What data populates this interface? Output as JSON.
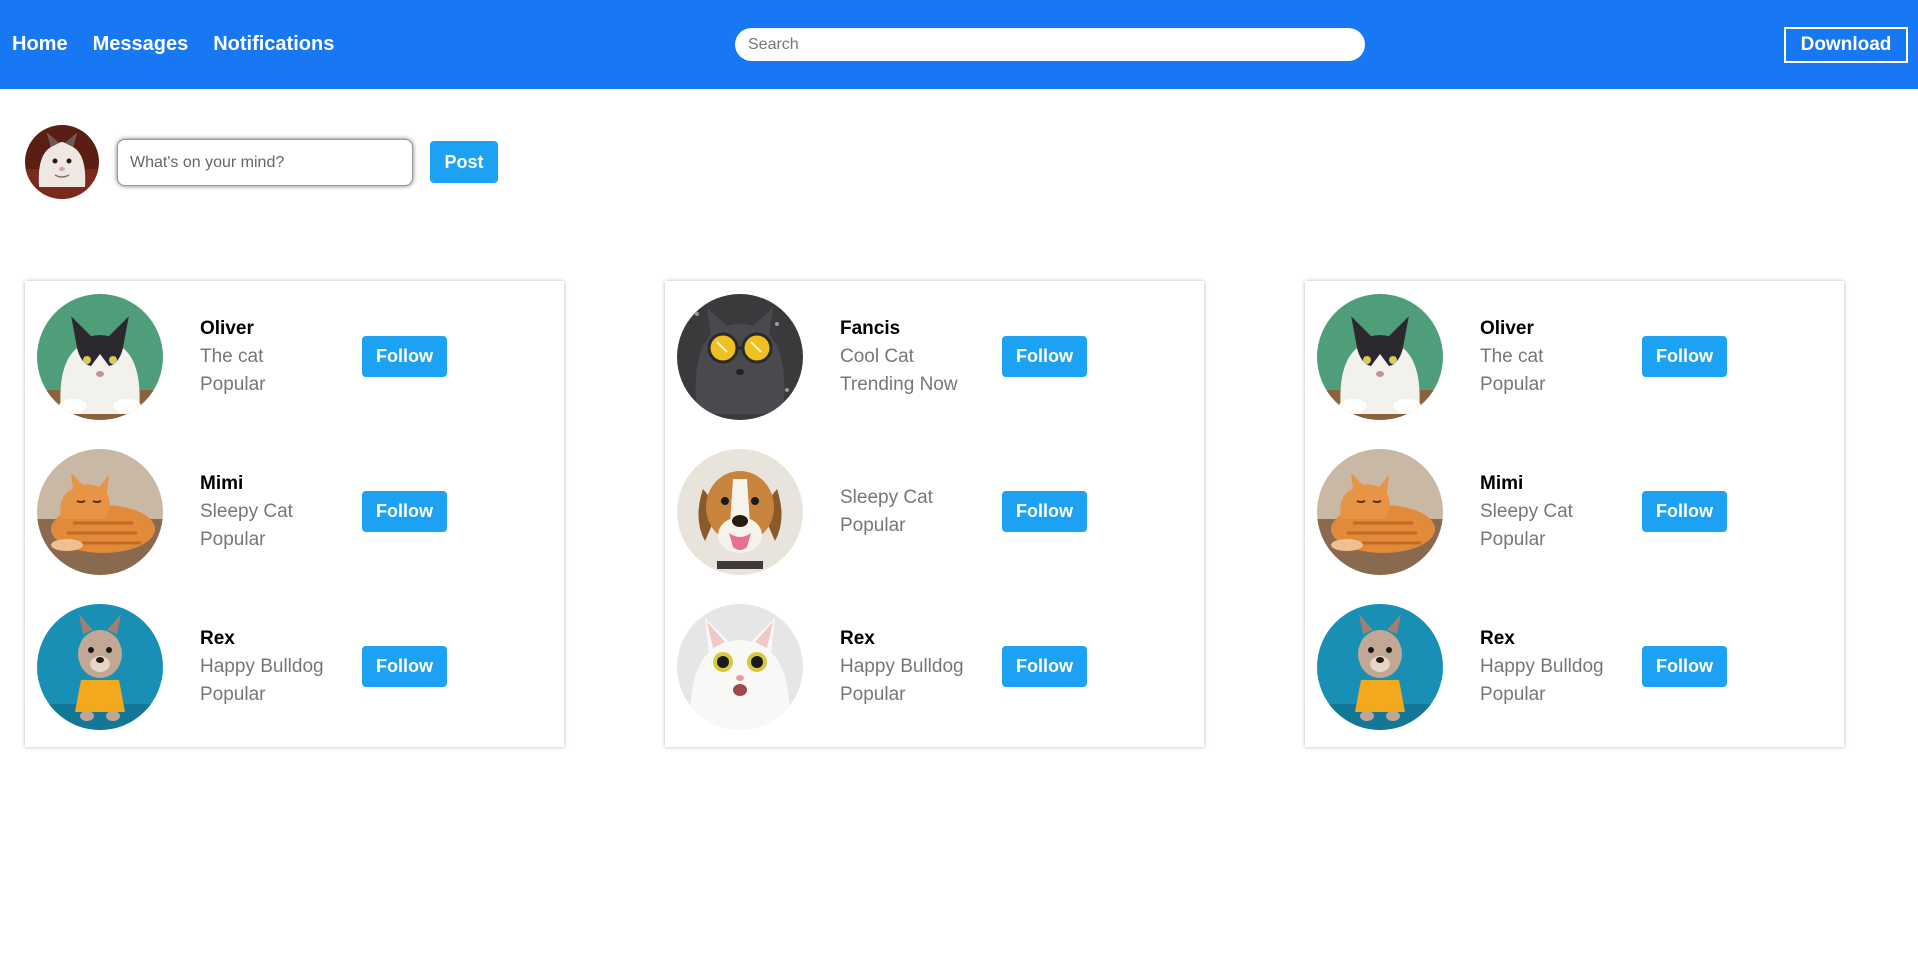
{
  "header": {
    "nav": [
      "Home",
      "Messages",
      "Notifications"
    ],
    "search_placeholder": "Search",
    "download_label": "Download"
  },
  "composer": {
    "placeholder": "What's on your mind?",
    "post_label": "Post"
  },
  "colors": {
    "header_bg": "#1877f2",
    "button_bg": "#1da1f2"
  },
  "cards": [
    {
      "items": [
        {
          "name": "Oliver",
          "line1": "The cat",
          "line2": "Popular",
          "follow": "Follow",
          "avatar": "tuxedo-cat"
        },
        {
          "name": "Mimi",
          "line1": "Sleepy Cat",
          "line2": "Popular",
          "follow": "Follow",
          "avatar": "orange-tabby-cat"
        },
        {
          "name": "Rex",
          "line1": "Happy Bulldog",
          "line2": "Popular",
          "follow": "Follow",
          "avatar": "french-bulldog"
        }
      ]
    },
    {
      "items": [
        {
          "name": "Fancis",
          "line1": "Cool Cat",
          "line2": "Trending Now",
          "follow": "Follow",
          "avatar": "cat-with-sunglasses"
        },
        {
          "name": "",
          "line1": "Sleepy Cat",
          "line2": "Popular",
          "follow": "Follow",
          "avatar": "beagle-dog"
        },
        {
          "name": "Rex",
          "line1": "Happy Bulldog",
          "line2": "Popular",
          "follow": "Follow",
          "avatar": "surprised-white-cat"
        }
      ]
    },
    {
      "items": [
        {
          "name": "Oliver",
          "line1": "The cat",
          "line2": "Popular",
          "follow": "Follow",
          "avatar": "tuxedo-cat"
        },
        {
          "name": "Mimi",
          "line1": "Sleepy Cat",
          "line2": "Popular",
          "follow": "Follow",
          "avatar": "orange-tabby-cat"
        },
        {
          "name": "Rex",
          "line1": "Happy Bulldog",
          "line2": "Popular",
          "follow": "Follow",
          "avatar": "french-bulldog"
        }
      ]
    }
  ]
}
